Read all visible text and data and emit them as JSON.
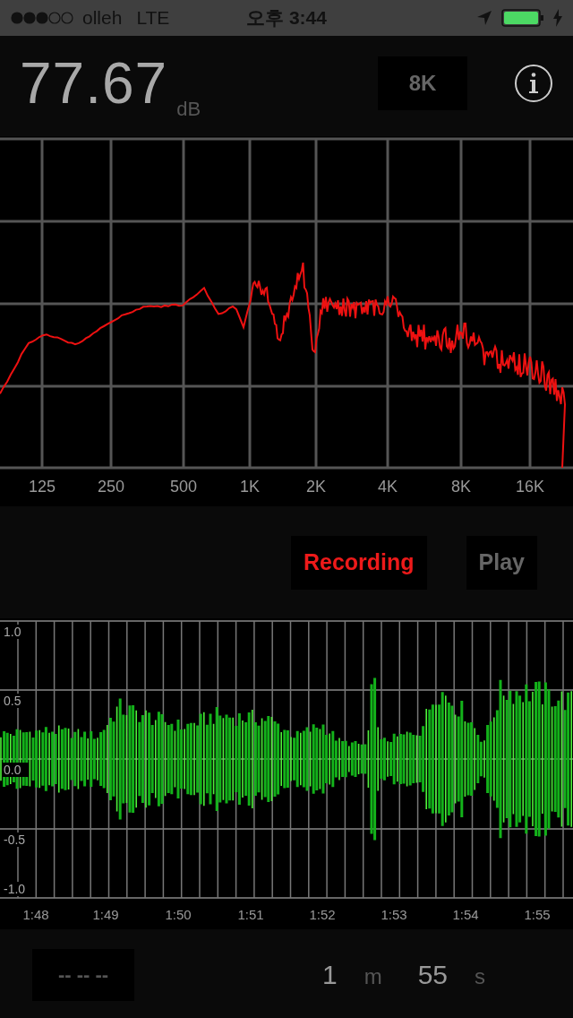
{
  "status_bar": {
    "carrier": "olleh",
    "network": "LTE",
    "time": "오후 3:44"
  },
  "meter": {
    "value": "77.67",
    "unit": "dB",
    "range_button": "8K"
  },
  "spectrum": {
    "x_labels": [
      "125",
      "250",
      "500",
      "1K",
      "2K",
      "4K",
      "8K",
      "16K"
    ]
  },
  "modes": [
    {
      "label": "Recording",
      "selected": true
    },
    {
      "label": "Play",
      "selected": false
    }
  ],
  "waveform": {
    "y_labels": [
      "1.0",
      "0.5",
      "0.0",
      "-0.5",
      "-1.0"
    ],
    "time_labels": [
      "1:48",
      "1:49",
      "1:50",
      "1:51",
      "1:52",
      "1:53",
      "1:54",
      "1:55"
    ]
  },
  "footer": {
    "display": "-- -- --",
    "minutes": "1",
    "minutes_unit": "m",
    "seconds": "55",
    "seconds_unit": "s"
  }
}
